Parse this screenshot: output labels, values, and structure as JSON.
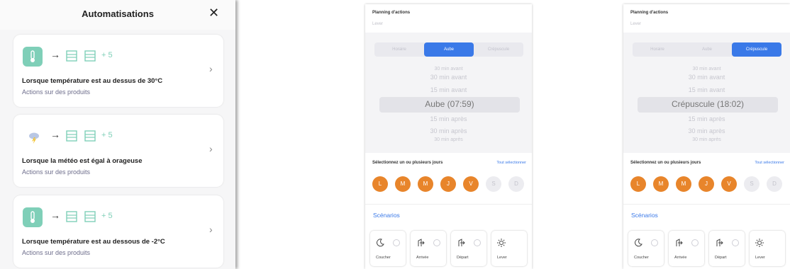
{
  "automations_panel": {
    "title": "Automatisations",
    "close_icon": "close-icon",
    "items": [
      {
        "trigger_icon": "thermometer-icon",
        "more": "+ 5",
        "title": "Lorsque température est au dessus de 30°C",
        "subtitle": "Actions sur des produits"
      },
      {
        "trigger_icon": "storm-weather-icon",
        "more": "+ 5",
        "title": "Lorsque la météo est égal à orageuse",
        "subtitle": "Actions sur des produits"
      },
      {
        "trigger_icon": "thermometer-icon",
        "more": "+ 5",
        "title": "Lorsque température est au dessous de -2°C",
        "subtitle": "Actions sur des produits"
      }
    ]
  },
  "phones": [
    {
      "planning_label": "Planning d'actions",
      "planning_value": "Lever",
      "segments": [
        "Horaire",
        "Aube",
        "Crépuscule"
      ],
      "active_segment": 1,
      "picker_above": [
        "30 min avant",
        "30 min avant",
        "15 min avant"
      ],
      "picker_selected": "Aube (07:59)",
      "picker_below": [
        "15 min après",
        "30 min après",
        "30 min après"
      ],
      "days_label": "Sélectionnez un ou plusieurs jours",
      "select_all": "Tout sélectionner",
      "days": [
        "L",
        "M",
        "M",
        "J",
        "V",
        "S",
        "D"
      ],
      "days_selected": [
        true,
        true,
        true,
        true,
        true,
        false,
        false
      ],
      "scenarios_title": "Scénarios",
      "scenarios": [
        "Coucher",
        "Arrivée",
        "Départ",
        "Lever"
      ]
    },
    {
      "planning_label": "Planning d'actions",
      "planning_value": "Lever",
      "segments": [
        "Horaire",
        "Aube",
        "Crépuscule"
      ],
      "active_segment": 2,
      "picker_above": [
        "30 min avant",
        "30 min avant",
        "15 min avant"
      ],
      "picker_selected": "Crépuscule (18:02)",
      "picker_below": [
        "15 min après",
        "30 min après",
        "30 min après"
      ],
      "days_label": "Sélectionnez un ou plusieurs jours",
      "select_all": "Tout sélectionner",
      "days": [
        "L",
        "M",
        "M",
        "J",
        "V",
        "S",
        "D"
      ],
      "days_selected": [
        true,
        true,
        true,
        true,
        true,
        false,
        false
      ],
      "scenarios_title": "Scénarios",
      "scenarios": [
        "Coucher",
        "Arrivée",
        "Départ",
        "Lever"
      ]
    }
  ],
  "colors": {
    "accent_blue": "#3a79e8",
    "day_orange": "#e8852b",
    "teal": "#7fcfb8"
  }
}
